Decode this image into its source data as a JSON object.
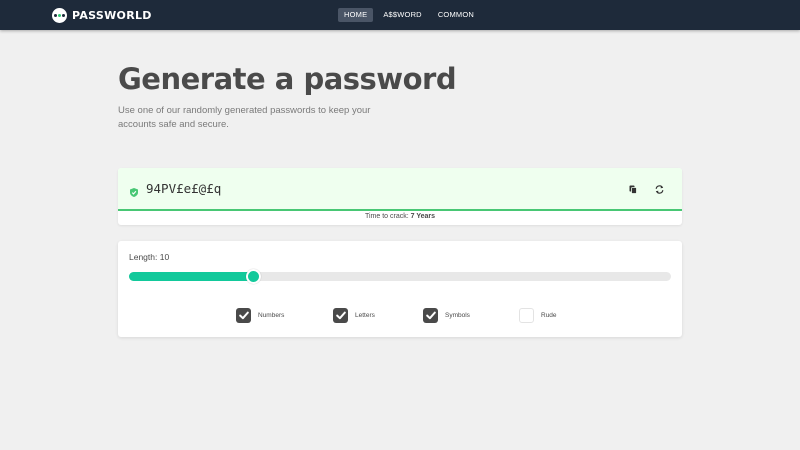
{
  "navbar": {
    "brand": "PASSWORLD",
    "links": [
      {
        "label": "HOME",
        "active": true
      },
      {
        "label": "A$$WORD",
        "active": false
      },
      {
        "label": "COMMON",
        "active": false
      }
    ]
  },
  "hero": {
    "title": "Generate a password",
    "subtitle": "Use one of our randomly generated passwords to keep your accounts safe and secure."
  },
  "password": {
    "value": "94PV£e£@£q",
    "strength": 1.0,
    "crack_label": "Time to crack:",
    "crack_time": "7 Years"
  },
  "options": {
    "length_label": "Length: 10",
    "length_fraction": 0.23,
    "checkboxes": [
      {
        "label": "Numbers",
        "checked": true
      },
      {
        "label": "Letters",
        "checked": true
      },
      {
        "label": "Symbols",
        "checked": true
      },
      {
        "label": "Rude",
        "checked": false
      }
    ]
  },
  "colors": {
    "navbar": "#1e2a3a",
    "accent": "#12c99b",
    "success": "#48c774",
    "password_bg": "#efffef"
  }
}
